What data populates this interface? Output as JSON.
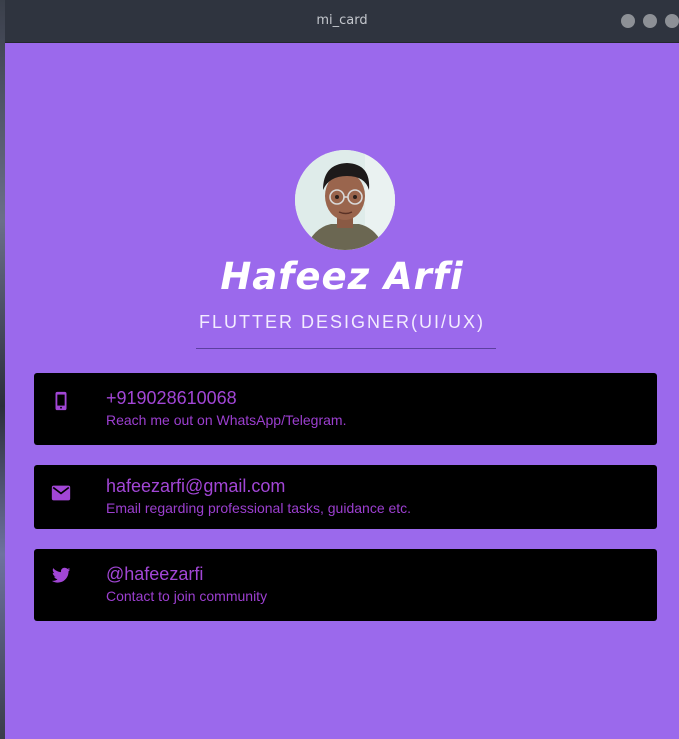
{
  "window": {
    "title": "mi_card"
  },
  "profile": {
    "name": "Hafeez Arfi",
    "subtitle": "FLUTTER DESIGNER(UI/UX)"
  },
  "contacts": [
    {
      "icon": "phone-icon",
      "title": "+919028610068",
      "subtitle": "Reach me out on WhatsApp/Telegram."
    },
    {
      "icon": "mail-icon",
      "title": "hafeezarfi@gmail.com",
      "subtitle": "Email regarding professional tasks, guidance etc."
    },
    {
      "icon": "twitter-icon",
      "title": "@hafeezarfi",
      "subtitle": "Contact to join community"
    }
  ],
  "colors": {
    "background": "#9b69ec",
    "card": "#000000",
    "accent": "#a246d6",
    "titlebar": "#2f343f"
  }
}
